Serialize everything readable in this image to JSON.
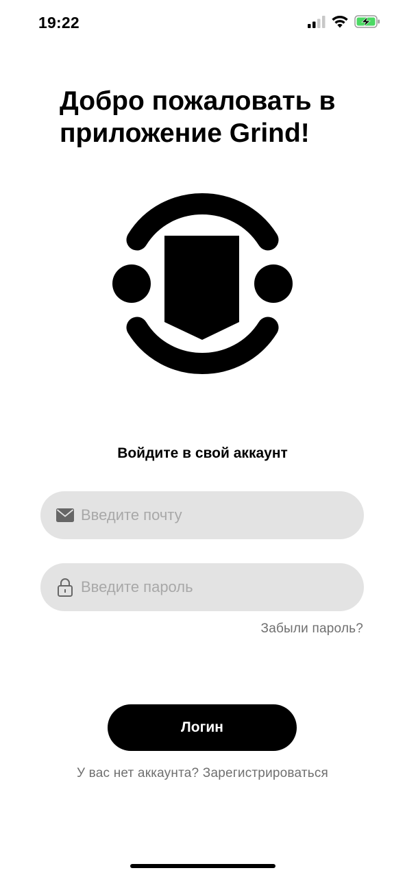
{
  "status_bar": {
    "time": "19:22",
    "icons": [
      "cellular-signal-icon",
      "wifi-icon",
      "battery-charging-icon"
    ],
    "battery_color": "#4cd964"
  },
  "welcome": {
    "title": "Добро пожаловать в приложение Grind!"
  },
  "logo": {
    "icon": "grind-logo-icon"
  },
  "login": {
    "subtitle": "Войдите в свой аккаунт",
    "email_placeholder": "Введите почту",
    "email_icon": "envelope-icon",
    "password_placeholder": "Введите пароль",
    "password_icon": "lock-icon",
    "forgot_password": "Забыли пароль?",
    "login_button": "Логин",
    "signup_text": "У вас нет аккаунта? Зарегистрироваться"
  },
  "colors": {
    "background": "#ffffff",
    "field_background": "#e3e3e3",
    "button_background": "#000000",
    "secondary_text": "#6f6f6f",
    "placeholder": "#a8a8a8"
  }
}
